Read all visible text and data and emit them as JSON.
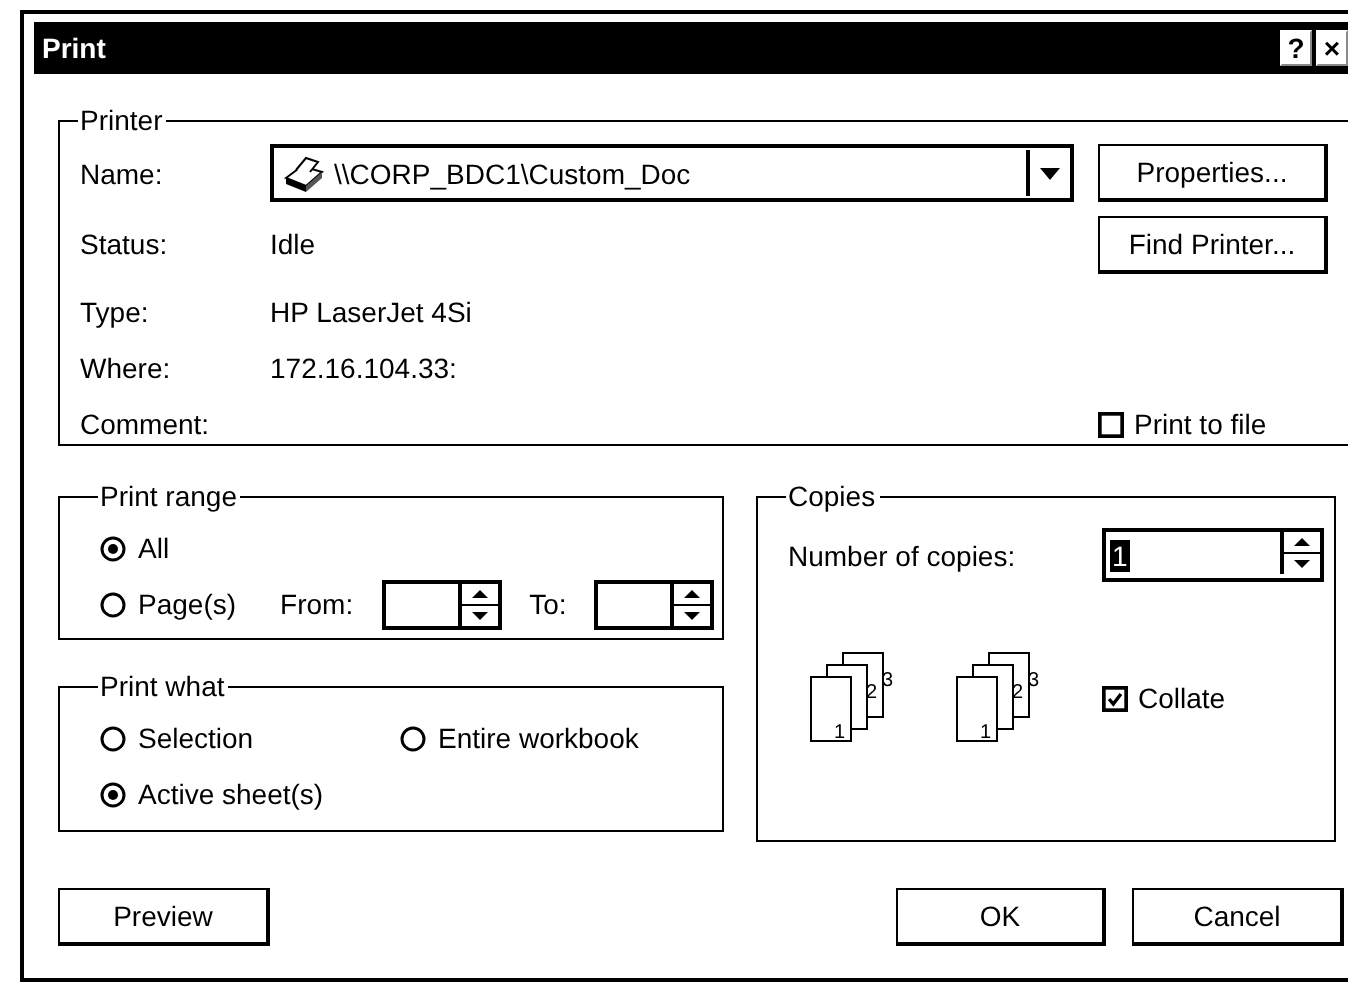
{
  "window": {
    "title": "Print",
    "help_button": "?",
    "close_button": "×"
  },
  "printer": {
    "title": "Printer",
    "name_label": "Name:",
    "name_value": "\\\\CORP_BDC1\\Custom_Doc",
    "properties_button": "Properties...",
    "find_button": "Find Printer...",
    "info": [
      {
        "label": "Status:",
        "value": "Idle"
      },
      {
        "label": "Type:",
        "value": "HP LaserJet 4Si"
      },
      {
        "label": "Where:",
        "value": "172.16.104.33:"
      },
      {
        "label": "Comment:"
      }
    ],
    "print_to_file": {
      "label": "Print to file",
      "checked": false
    }
  },
  "print_range": {
    "title": "Print range",
    "options": [
      {
        "label": "All",
        "selected": true
      },
      {
        "label": "Page(s)",
        "selected": false
      }
    ],
    "from_label": "From:",
    "to_label": "To:"
  },
  "print_what": {
    "title": "Print what",
    "options": [
      {
        "label": "Selection",
        "selected": false
      },
      {
        "label": "Entire workbook",
        "selected": false
      },
      {
        "label": "Active sheet(s)",
        "selected": true
      }
    ]
  },
  "copies": {
    "title": "Copies",
    "label": "Number of copies:",
    "value": "1",
    "collate_stacks": [
      {
        "pages": [
          "1",
          "2",
          "3"
        ]
      },
      {
        "pages": [
          "1",
          "2",
          "3"
        ]
      }
    ],
    "collate": {
      "label": "Collate",
      "checked": true
    }
  },
  "buttons": [
    {
      "label": "Preview"
    },
    {
      "label": "OK"
    },
    {
      "label": "Cancel"
    }
  ]
}
